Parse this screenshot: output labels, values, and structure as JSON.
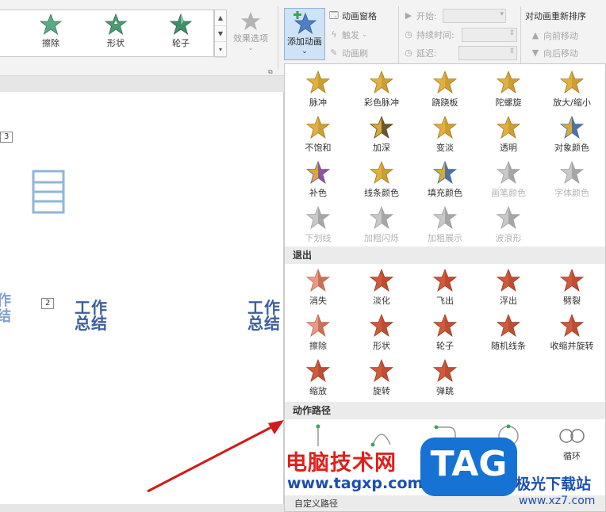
{
  "ribbon": {
    "gallery_items": [
      {
        "label": "擦除",
        "icon": "wipe-star-icon"
      },
      {
        "label": "形状",
        "icon": "shape-star-icon"
      },
      {
        "label": "轮子",
        "icon": "wheel-star-icon"
      }
    ],
    "effect_options_label": "效果选项",
    "add_animation_label": "添加动画",
    "animation_pane_label": "动画窗格",
    "trigger_label": "触发",
    "animation_painter_label": "动画刷",
    "start_label": "开始:",
    "duration_label": "持续时间:",
    "delay_label": "延迟:",
    "reorder_title": "对动画重新排序",
    "move_earlier_label": "向前移动",
    "move_later_label": "向后移动"
  },
  "slide": {
    "tag_3": "3",
    "tag_2": "2",
    "title_1_line1": "工作",
    "title_1_line2": "总结",
    "title_2_line1": "工作",
    "title_2_line2": "总结",
    "partial_left_line1": "作",
    "partial_left_line2": "结"
  },
  "panel": {
    "emphasis_row1": [
      "脉冲",
      "彩色脉冲",
      "跷跷板",
      "陀螺旋",
      "放大/缩小"
    ],
    "emphasis_row2": [
      "不饱和",
      "加深",
      "变淡",
      "透明",
      "对象颜色"
    ],
    "emphasis_row3": [
      "补色",
      "线条颜色",
      "填充颜色",
      "画笔颜色",
      "字体颜色"
    ],
    "emphasis_row4": [
      "下划线",
      "加粗闪烁",
      "加粗展示",
      "波浪形"
    ],
    "exit_header": "退出",
    "exit_row1": [
      "消失",
      "淡化",
      "飞出",
      "浮出",
      "劈裂"
    ],
    "exit_row2": [
      "擦除",
      "形状",
      "轮子",
      "随机线条",
      "收缩并旋转"
    ],
    "exit_row3": [
      "缩放",
      "旋转",
      "弹跳"
    ],
    "motion_header": "动作路径",
    "motion_visible_label": "循环",
    "custom_path_label": "自定义路径"
  },
  "watermark": {
    "site_cn": "电脑技术网",
    "site_url": "www.tagxp.com",
    "tag": "TAG",
    "site2_cn": "极光下载站",
    "site2_url": "www.xz7.com"
  },
  "colors": {
    "emphasis_gold": "#d8a93a",
    "exit_red": "#c84c32",
    "entrance_green": "#4c9a74",
    "disabled_gray": "#b8b8b8",
    "accent_blue": "#3a5f9a"
  }
}
